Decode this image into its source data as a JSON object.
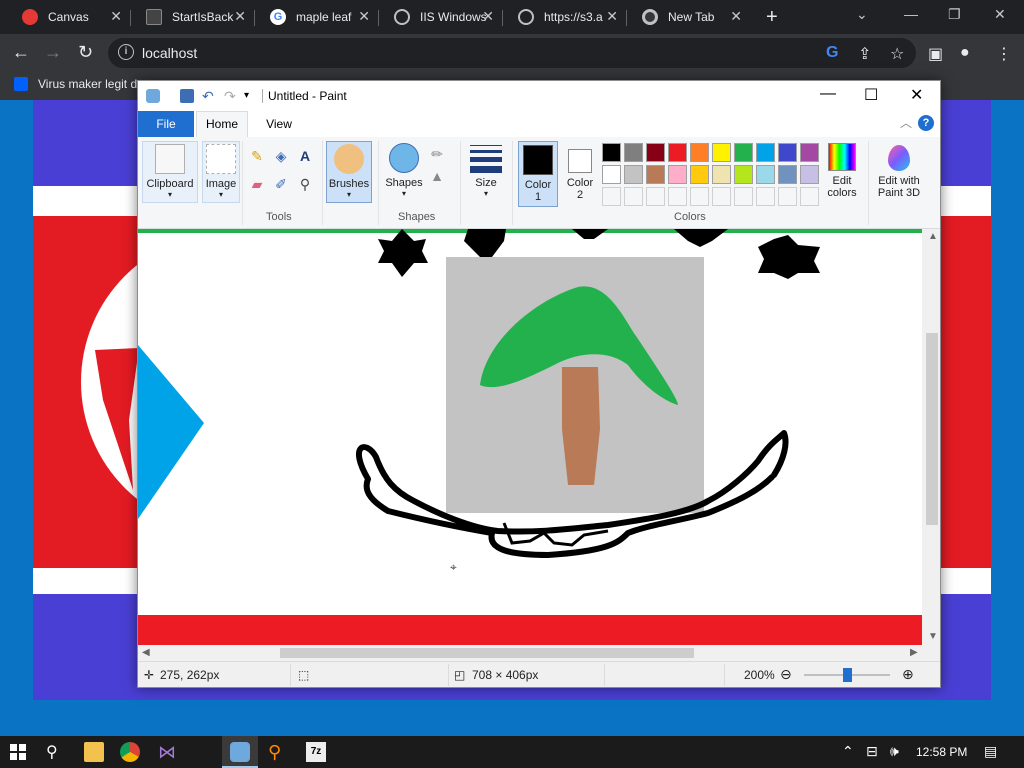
{
  "browser": {
    "tabs": [
      {
        "title": "Canvas",
        "favicon": "canvas-icon",
        "color": "#e53935"
      },
      {
        "title": "StartIsBack",
        "favicon": "terminal-icon",
        "color": "#444444"
      },
      {
        "title": "maple leaf",
        "favicon": "google-icon",
        "color": "#ffffff"
      },
      {
        "title": "IIS Windows",
        "favicon": "globe-icon",
        "color": "#bdc1c6"
      },
      {
        "title": "https://s3.a",
        "favicon": "globe-icon",
        "color": "#bdc1c6"
      },
      {
        "title": "New Tab",
        "favicon": "chrome-icon",
        "color": "#bdc1c6"
      }
    ],
    "new_tab_symbol": "+",
    "address": "localhost",
    "bookmark": "Virus maker legit d"
  },
  "paint": {
    "window_title": "Untitled - Paint",
    "menu_tabs": {
      "file": "File",
      "home": "Home",
      "view": "View"
    },
    "ribbon": {
      "clipboard": "Clipboard",
      "image": "Image",
      "tools": "Tools",
      "brushes": "Brushes",
      "shapes": "Shapes",
      "shapes_group": "Shapes",
      "size": "Size",
      "color1_line1": "Color",
      "color1_line2": "1",
      "color2_line1": "Color",
      "color2_line2": "2",
      "colors_group": "Colors",
      "edit_colors_line1": "Edit",
      "edit_colors_line2": "colors",
      "edit3d_line1": "Edit with",
      "edit3d_line2": "Paint 3D"
    },
    "palette_row1": [
      "#000000",
      "#7f7f7f",
      "#880015",
      "#ed1c24",
      "#ff7f27",
      "#fff200",
      "#22b14c",
      "#00a2e8",
      "#3f48cc",
      "#a349a4"
    ],
    "palette_row2": [
      "#ffffff",
      "#c3c3c3",
      "#b97a57",
      "#ffaec9",
      "#ffc90e",
      "#efe4b0",
      "#b5e61d",
      "#99d9ea",
      "#7092be",
      "#c8bfe7"
    ],
    "color1": "#000000",
    "color2": "#ffffff",
    "status": {
      "cursor_pos": "275, 262px",
      "canvas_size": "708 × 406px",
      "zoom": "200%",
      "zoom_level_percent": 50
    }
  },
  "taskbar": {
    "time": "12:58 PM"
  }
}
